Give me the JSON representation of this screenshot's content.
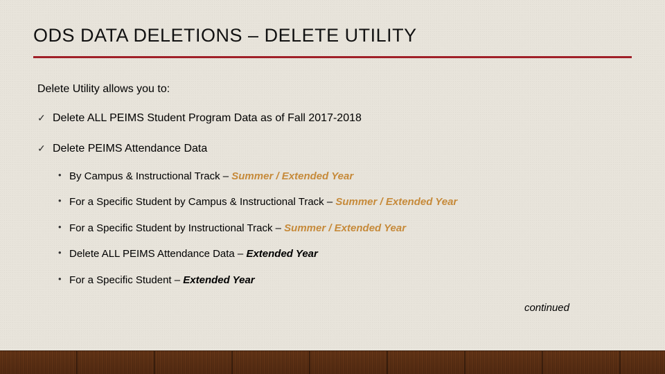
{
  "title": "ODS DATA DELETIONS – DELETE UTILITY",
  "intro": "Delete Utility allows you to:",
  "checks": [
    {
      "text": "Delete ALL PEIMS Student Program Data as of Fall 2017-2018"
    },
    {
      "text": "Delete PEIMS Attendance Data"
    }
  ],
  "sub": [
    {
      "prefix": "By Campus & Instructional Track – ",
      "emph": "Summer / Extended Year",
      "style": "orange"
    },
    {
      "prefix": "For a Specific Student by Campus & Instructional Track – ",
      "emph": "Summer / Extended Year",
      "style": "orange"
    },
    {
      "prefix": "For a Specific Student by Instructional Track – ",
      "emph": "Summer / Extended Year",
      "style": "orange"
    },
    {
      "prefix": "Delete ALL PEIMS Attendance Data – ",
      "emph": "Extended Year",
      "style": "bold"
    },
    {
      "prefix": "For a Specific Student – ",
      "emph": "Extended Year",
      "style": "bold"
    }
  ],
  "continued": "continued"
}
